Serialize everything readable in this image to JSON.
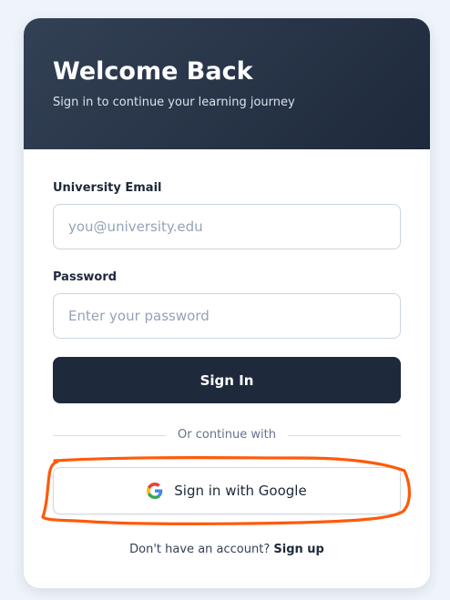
{
  "header": {
    "title": "Welcome Back",
    "subtitle": "Sign in to continue your learning journey"
  },
  "form": {
    "email": {
      "label": "University Email",
      "value": "",
      "placeholder": "you@university.edu"
    },
    "password": {
      "label": "Password",
      "value": "",
      "placeholder": "Enter your password"
    },
    "submit_label": "Sign In"
  },
  "divider_text": "Or continue with",
  "google": {
    "label": "Sign in with Google",
    "icon": "google-g-icon"
  },
  "signup": {
    "prompt": "Don't have an account?",
    "link": "Sign up"
  },
  "colors": {
    "primary": "#1e293b",
    "header_gradient_start": "#334155",
    "annotation": "#ff5a0a",
    "background": "#eff4fb"
  }
}
